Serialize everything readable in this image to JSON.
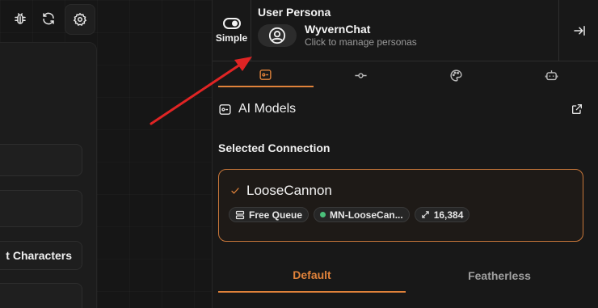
{
  "left": {
    "toolbar_icons": [
      "bug-icon",
      "refresh-icon",
      "gear-icon"
    ],
    "characters_button_label": "t Characters"
  },
  "persona": {
    "toggle_label": "Simple",
    "title": "User Persona",
    "name": "WyvernChat",
    "subtitle": "Click to manage personas"
  },
  "tabs": [
    {
      "icon": "models-icon",
      "active": true
    },
    {
      "icon": "connection-icon",
      "active": false
    },
    {
      "icon": "palette-icon",
      "active": false
    },
    {
      "icon": "bot-icon",
      "active": false
    }
  ],
  "section": {
    "title": "AI Models",
    "selected_label": "Selected Connection"
  },
  "model": {
    "name": "LooseCannon",
    "chips": {
      "queue": "Free Queue",
      "model_id": "MN-LooseCan...",
      "context": "16,384"
    }
  },
  "sub_tabs": [
    "Default",
    "Featherless"
  ],
  "colors": {
    "accent": "#e0823a",
    "annotation_arrow": "#e02424",
    "status_dot": "#4ac07a"
  }
}
